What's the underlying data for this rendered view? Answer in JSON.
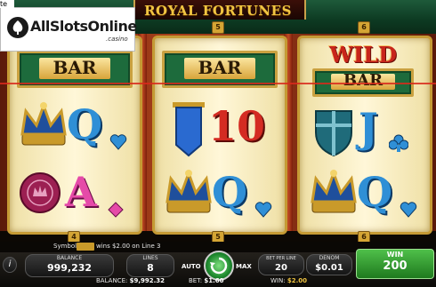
{
  "corner_text": "te",
  "logo": {
    "brand": "AllSlotsOnline",
    "sub": ".casino"
  },
  "title": "ROYAL FORTUNES",
  "reels": [
    {
      "top": "BAR",
      "middle": "Q",
      "bottom": "A"
    },
    {
      "top": "BAR",
      "middle": "10",
      "bottom": "Q"
    },
    {
      "top_line1": "WILD",
      "top_line2": "BAR",
      "middle": "J",
      "bottom": "Q"
    }
  ],
  "line_markers": {
    "top_center": "5",
    "top_right": "6",
    "bottom_left": "4",
    "bottom_center": "5",
    "bottom_right": "6"
  },
  "message": {
    "prefix": "Symbol",
    "suffix": "wins $2.00 on Line 3"
  },
  "controls": {
    "info": "i",
    "balance_label": "BALANCE",
    "balance_value": "999,232",
    "lines_label": "LINES",
    "lines_value": "8",
    "auto": "AUTO",
    "max": "MAX",
    "bet_per_line_label": "BET PER LINE",
    "bet_per_line_value": "20",
    "denom_label": "DENOM",
    "denom_value": "$0.01",
    "win_label": "WIN",
    "win_value": "200"
  },
  "footer": {
    "balance_label": "BALANCE:",
    "balance_value": "$9,992.32",
    "bet_label": "BET:",
    "bet_value": "$1.60",
    "win_label": "WIN:",
    "win_value": "$2.00"
  },
  "colors": {
    "accent_gold": "#f0c542",
    "felt_green": "#1d6b3c",
    "line_red": "#d8291b"
  }
}
